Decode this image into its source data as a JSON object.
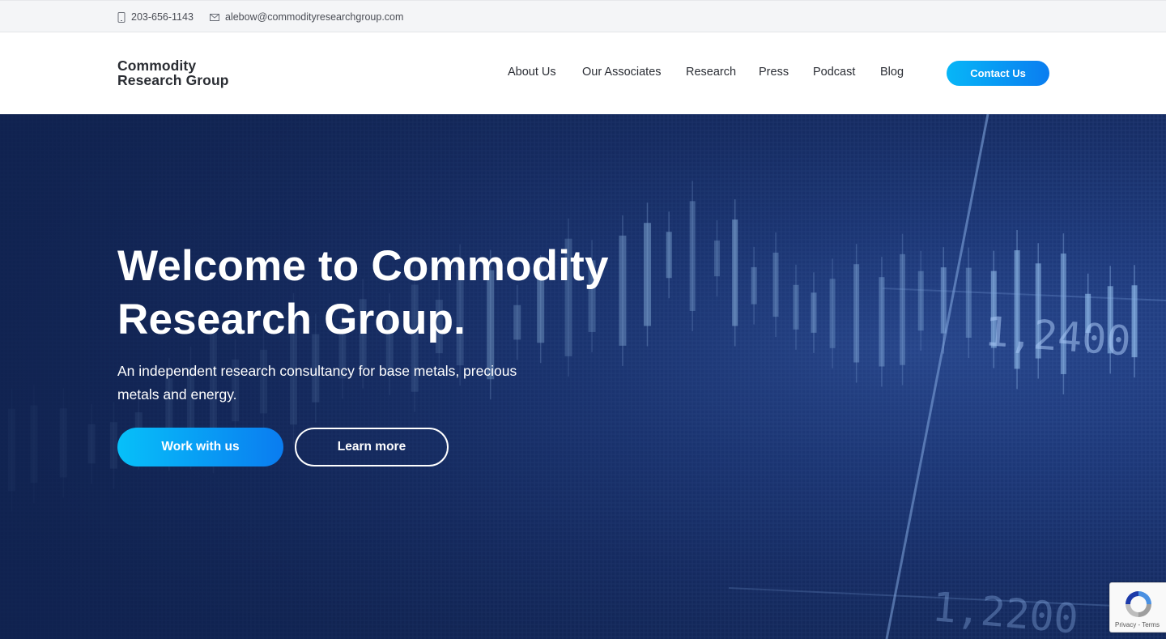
{
  "topbar": {
    "phone": "203-656-1143",
    "email": "alebow@commodityresearchgroup.com"
  },
  "logo": {
    "line1": "Commodity",
    "line2": "Research Group"
  },
  "nav": {
    "items": [
      "About Us",
      "Our Associates",
      "Research",
      "Press",
      "Podcast",
      "Blog"
    ],
    "cta": "Contact Us"
  },
  "hero": {
    "title_line1": "Welcome to Commodity",
    "title_line2": "Research Group.",
    "subtitle": "An independent research consultancy for base metals, precious metals and energy.",
    "primary_button": "Work with us",
    "secondary_button": "Learn more",
    "background_labels": [
      "1,2400",
      "1,2200"
    ]
  },
  "recaptcha": {
    "text": "Privacy - Terms"
  },
  "colors": {
    "accent_start": "#07c0f9",
    "accent_end": "#0a7cf0",
    "hero_bg": "#172e67"
  }
}
